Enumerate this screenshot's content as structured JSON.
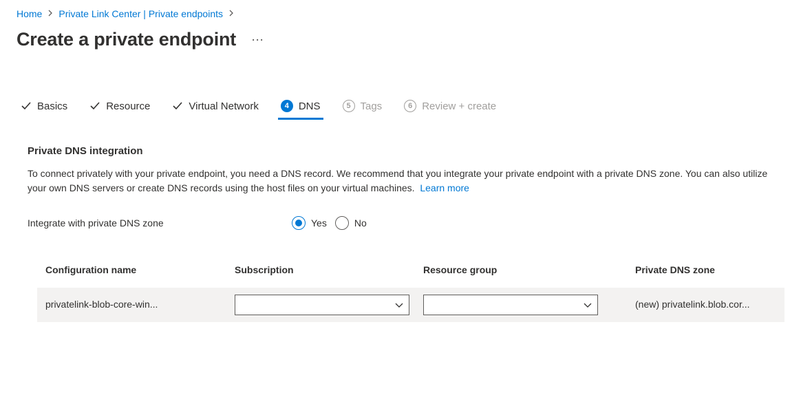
{
  "breadcrumb": {
    "items": [
      "Home",
      "Private Link Center | Private endpoints"
    ]
  },
  "page_title": "Create a private endpoint",
  "tabs": [
    {
      "label": "Basics",
      "status": "done"
    },
    {
      "label": "Resource",
      "status": "done"
    },
    {
      "label": "Virtual Network",
      "status": "done"
    },
    {
      "label": "DNS",
      "step": "4",
      "status": "active"
    },
    {
      "label": "Tags",
      "step": "5",
      "status": "pending"
    },
    {
      "label": "Review + create",
      "step": "6",
      "status": "pending"
    }
  ],
  "dns_section": {
    "heading": "Private DNS integration",
    "description": "To connect privately with your private endpoint, you need a DNS record. We recommend that you integrate your private endpoint with a private DNS zone. You can also utilize your own DNS servers or create DNS records using the host files on your virtual machines.",
    "learn_more": "Learn more",
    "integrate_label": "Integrate with private DNS zone",
    "options": {
      "yes": "Yes",
      "no": "No"
    },
    "selected": "yes",
    "table": {
      "headers": [
        "Configuration name",
        "Subscription",
        "Resource group",
        "Private DNS zone"
      ],
      "rows": [
        {
          "config_name": "privatelink-blob-core-win...",
          "subscription": "",
          "resource_group": "",
          "dns_zone": "(new) privatelink.blob.cor..."
        }
      ]
    }
  }
}
